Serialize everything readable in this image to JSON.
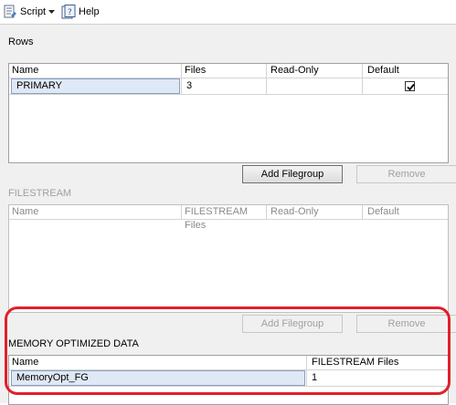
{
  "toolbar": {
    "script_label": "Script",
    "help_label": "Help"
  },
  "rows_section": {
    "title": "Rows",
    "columns": [
      "Name",
      "Files",
      "Read-Only",
      "Default"
    ],
    "rows": [
      {
        "name": "PRIMARY",
        "files": "3",
        "read_only": "",
        "default_checked": true
      }
    ],
    "add_button": "Add Filegroup",
    "remove_button": "Remove"
  },
  "filestream_section": {
    "title": "FILESTREAM",
    "columns": [
      "Name",
      "FILESTREAM Files",
      "Read-Only",
      "Default"
    ],
    "add_button": "Add Filegroup",
    "remove_button": "Remove"
  },
  "memory_section": {
    "title": "MEMORY OPTIMIZED DATA",
    "columns": [
      "Name",
      "FILESTREAM Files"
    ],
    "rows": [
      {
        "name": "MemoryOpt_FG",
        "files": "1"
      }
    ]
  },
  "colors": {
    "highlight": "#e0202a",
    "selected_cell": "#dfe8f5"
  }
}
